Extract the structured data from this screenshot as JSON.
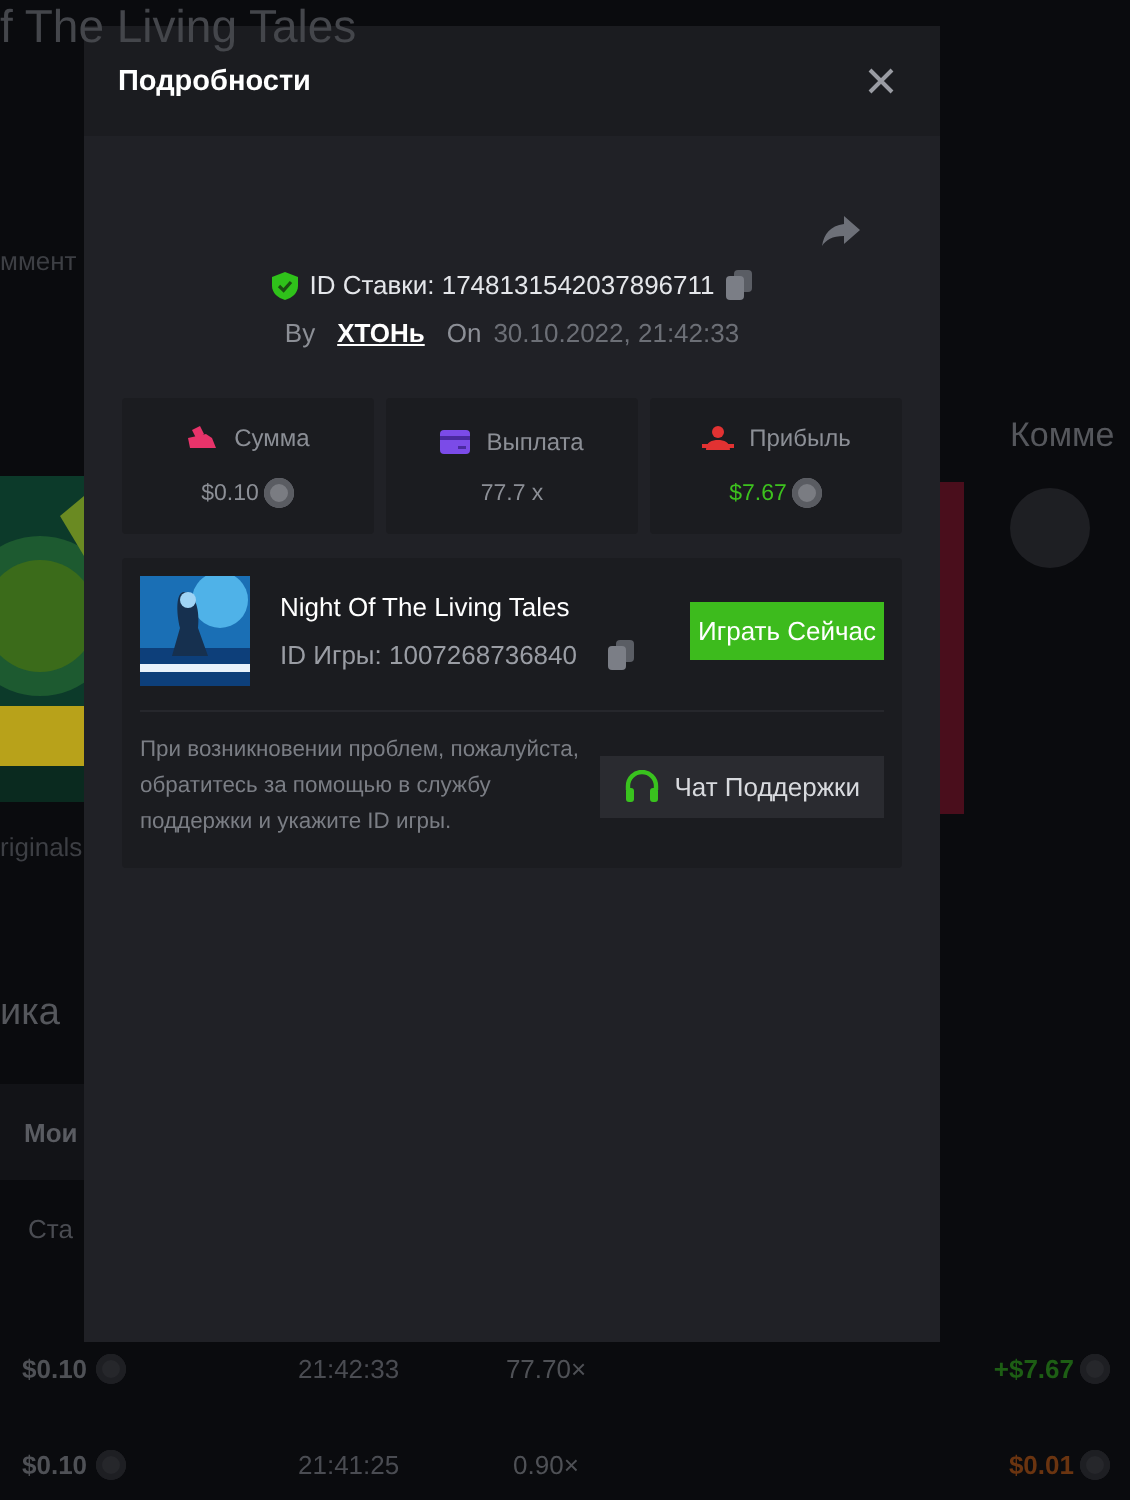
{
  "background": {
    "title": "f The Living Tales",
    "comments_label": "ммент",
    "category": "riginals",
    "section_title": "ика",
    "tab": "Мои",
    "column_header": "Ста",
    "right_heading": "Комме",
    "rows": [
      {
        "amount": "$0.10",
        "time": "21:42:33",
        "multiplier": "77.70×",
        "profit": "+$7.67",
        "win": true
      },
      {
        "amount": "$0.10",
        "time": "21:41:25",
        "multiplier": "0.90×",
        "profit": "$0.01",
        "win": false
      }
    ]
  },
  "modal": {
    "title": "Подробности",
    "bet_id": "ID Ставки: 1748131542037896711",
    "by_label": "By",
    "user": "ХТОНь",
    "on_label": "On",
    "date": "30.10.2022, 21:42:33",
    "stats": [
      {
        "kind": "amount",
        "label": "Сумма",
        "value": "$0.10",
        "coin": true,
        "positive": false
      },
      {
        "kind": "payout",
        "label": "Выплата",
        "value": "77.7 x",
        "coin": false,
        "positive": false
      },
      {
        "kind": "profit",
        "label": "Прибыль",
        "value": "$7.67",
        "coin": true,
        "positive": true
      }
    ],
    "game": {
      "name": "Night Of The Living Tales",
      "game_id": "ID Игры: 1007268736840",
      "play_button": "Играть Сейчас"
    },
    "help_text": "При возникновении проблем, пожалуйста, обратитесь за помощью в службу поддержки и укажите ID игры.",
    "support_button": "Чат Поддержки"
  }
}
